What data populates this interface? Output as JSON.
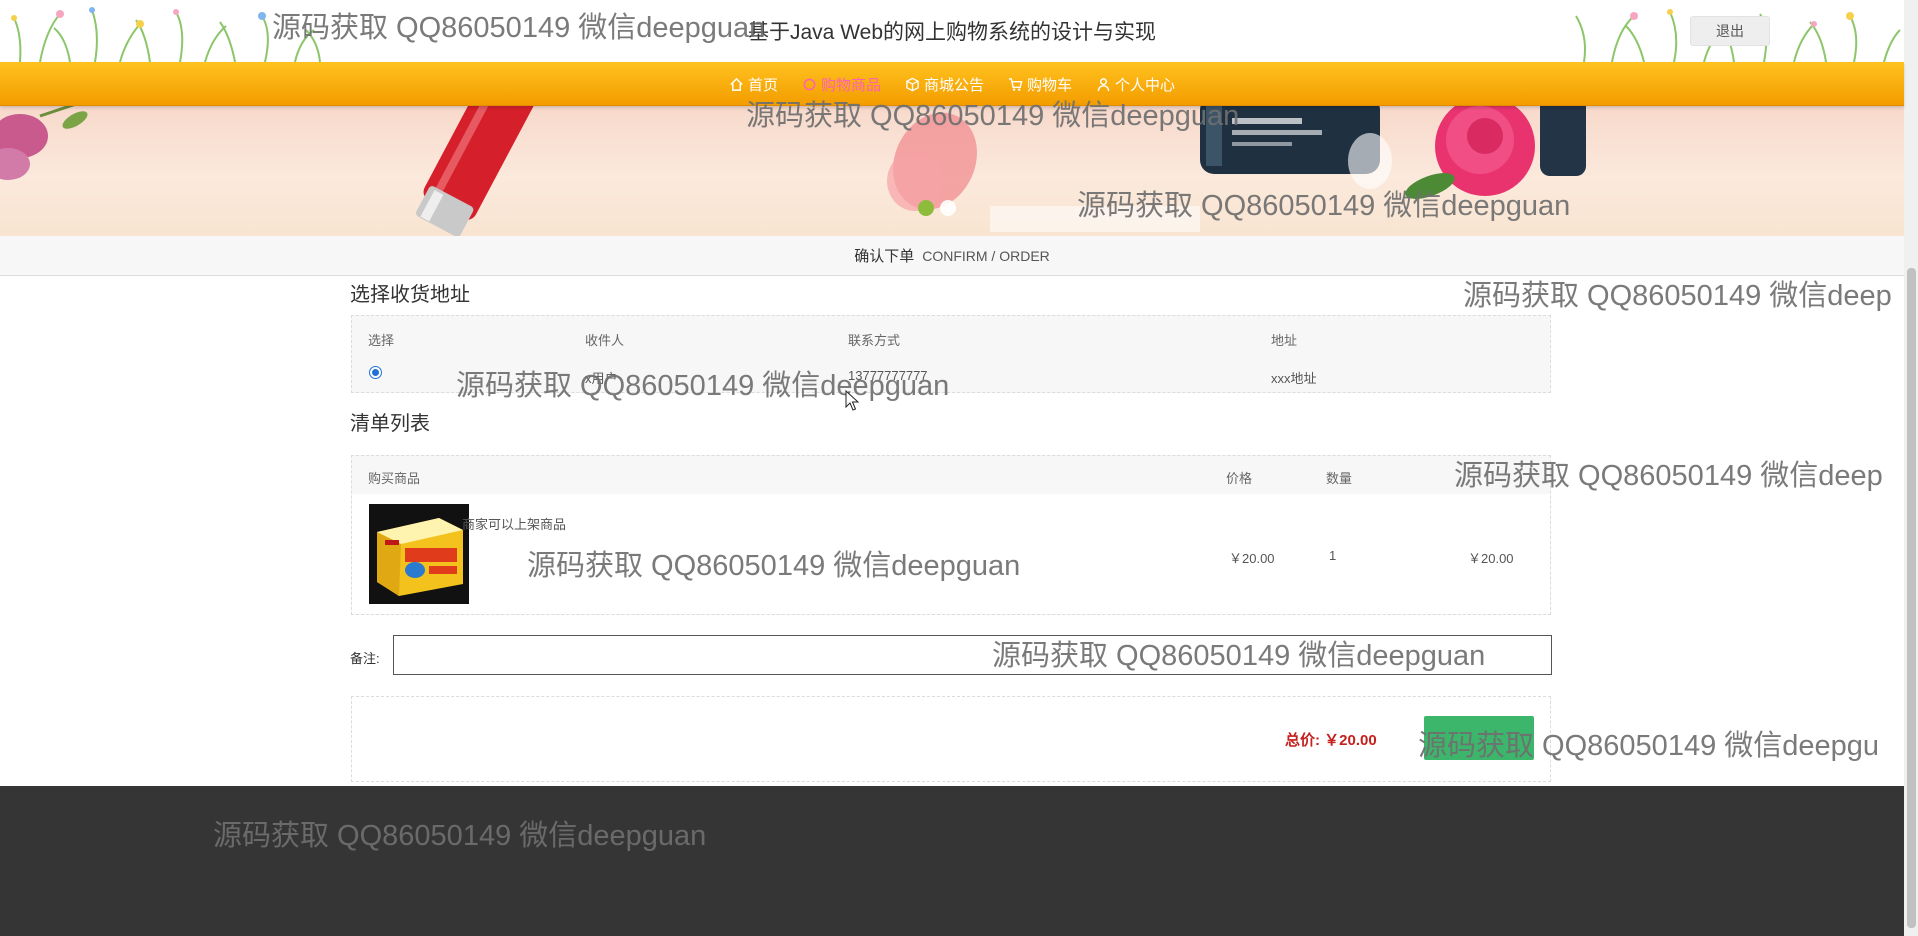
{
  "header": {
    "title": "基于Java Web的网上购物系统的设计与实现",
    "logout_label": "退出"
  },
  "nav": {
    "items": [
      {
        "label": "首页",
        "icon": "home-icon",
        "active": false
      },
      {
        "label": "购物商品",
        "icon": "circle-icon",
        "active": true
      },
      {
        "label": "商城公告",
        "icon": "cube-icon",
        "active": false
      },
      {
        "label": "购物车",
        "icon": "cart-icon",
        "active": false
      },
      {
        "label": "个人中心",
        "icon": "user-icon",
        "active": false
      }
    ],
    "active_color": "#ff5fb6"
  },
  "banner": {
    "slide_dots": 2,
    "active_dot": 0
  },
  "section": {
    "title_cn": "确认下单",
    "title_en": "CONFIRM / ORDER"
  },
  "address": {
    "title": "选择收货地址",
    "headers": [
      "选择",
      "收件人",
      "联系方式",
      "地址"
    ],
    "rows": [
      {
        "selected": true,
        "recipient": "x用户",
        "phone": "13777777777",
        "address": "xxx地址"
      }
    ]
  },
  "order_list": {
    "title": "清单列表",
    "headers": [
      "购买商品",
      "价格",
      "数量"
    ],
    "items": [
      {
        "name": "商家可以上架商品",
        "price": "￥20.00",
        "quantity": "1",
        "subtotal": "￥20.00"
      }
    ]
  },
  "remark": {
    "label": "备注:",
    "value": ""
  },
  "total": {
    "label": "总价: ￥20.00",
    "color": "#c4201d"
  },
  "submit": {
    "color": "#3cb66b"
  },
  "watermarks": [
    "源码获取 QQ86050149 微信deepguan",
    "源码获取 QQ86050149 微信deepguan",
    "源码获取 QQ86050149 微信deepguan",
    "源码获取 QQ86050149 微信deep",
    "源码获取 QQ86050149 微信deepguan",
    "源码获取 QQ86050149 微信deep",
    "源码获取 QQ86050149 微信deepguan",
    "源码获取 QQ86050149 微信deepguan",
    "源码获取 QQ86050149 微信deepgu",
    "源码获取 QQ86050149 微信deepguan"
  ]
}
